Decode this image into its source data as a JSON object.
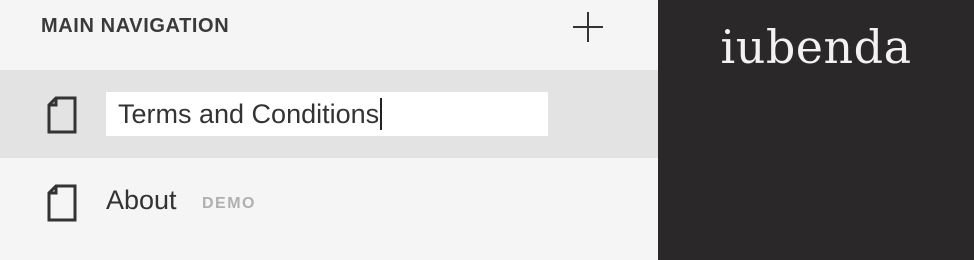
{
  "navigation": {
    "section_title": "MAIN NAVIGATION",
    "add_icon": "plus-icon",
    "items": [
      {
        "label": "Terms and Conditions",
        "state": "editing",
        "icon": "page-icon"
      },
      {
        "label": "About",
        "badge": "DEMO",
        "icon": "page-icon"
      }
    ]
  },
  "brand": {
    "logo_text": "iubenda",
    "background": "#2a2829"
  },
  "colors": {
    "panel_bg": "#f5f5f5",
    "active_row_bg": "#e3e3e3",
    "text": "#333333",
    "badge": "#b0b0b0"
  }
}
